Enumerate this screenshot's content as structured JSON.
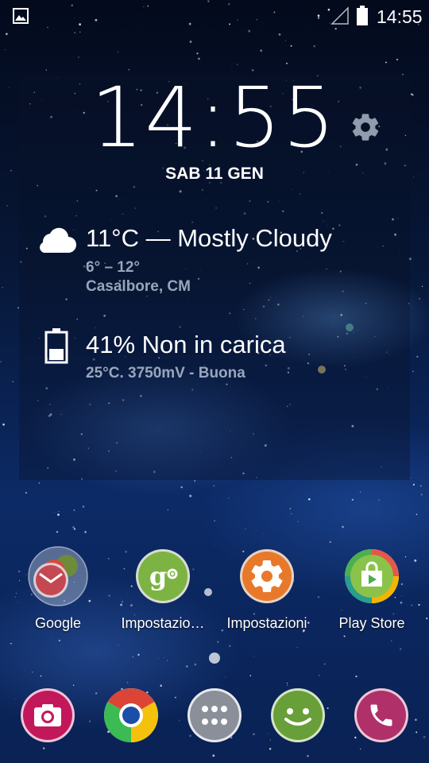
{
  "status_bar": {
    "time": "14:55",
    "icons": [
      "image-notification-icon",
      "signal-icon",
      "battery-icon"
    ]
  },
  "widget": {
    "clock": "14:55",
    "date": "SAB 11 GEN",
    "settings_icon": "gear-icon",
    "weather": {
      "icon": "cloud-icon",
      "summary": "11°C — Mostly Cloudy",
      "range": "6° – 12°",
      "location": "Casalbore, CM"
    },
    "battery": {
      "icon": "battery-icon",
      "summary": "41% Non in carica",
      "details": "25°C. 3750mV - Buona",
      "level": 0.41
    }
  },
  "apps": [
    {
      "label": "Google",
      "icon": "google-folder-icon"
    },
    {
      "label": "Impostazio…",
      "icon": "google-settings-icon"
    },
    {
      "label": "Impostazioni",
      "icon": "settings-icon"
    },
    {
      "label": "Play Store",
      "icon": "play-store-icon"
    }
  ],
  "page_indicator": {
    "pages": 1,
    "current": 1
  },
  "dock": [
    {
      "icon": "camera-icon"
    },
    {
      "icon": "chrome-icon"
    },
    {
      "icon": "app-drawer-icon"
    },
    {
      "icon": "messenger-icon"
    },
    {
      "icon": "phone-icon"
    }
  ],
  "colors": {
    "google_settings_bg": "#7cb342",
    "settings_bg": "#e8782a",
    "camera_bg": "#c2185b",
    "messenger_bg": "#689f38",
    "phone_bg": "#b0306a"
  }
}
